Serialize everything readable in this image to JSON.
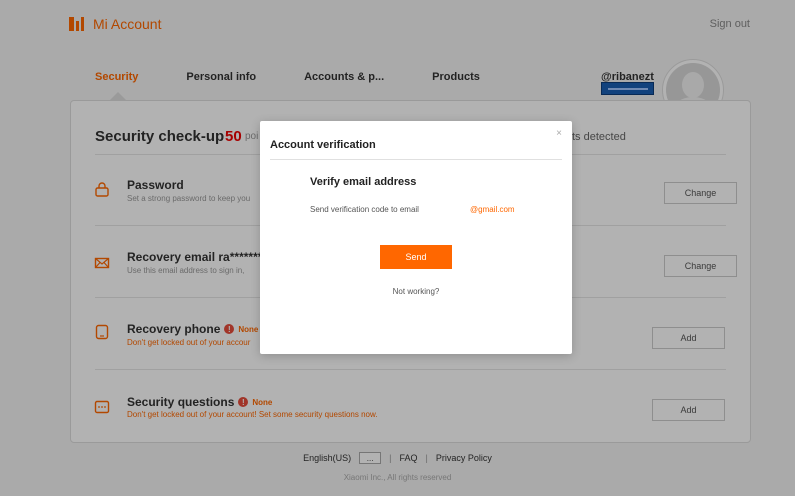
{
  "header": {
    "brand": "Mi Account",
    "sign_out": "Sign out"
  },
  "tabs": [
    "Security",
    "Personal info",
    "Accounts & p...",
    "Products"
  ],
  "user": {
    "name": "@ribanezt"
  },
  "checkup": {
    "title": "Security check-up",
    "score": "50",
    "points": "poi",
    "status": "ts detected"
  },
  "rows": [
    {
      "title": "Password",
      "desc": "Set a strong password to keep you",
      "button": "Change"
    },
    {
      "title": "Recovery email ra********",
      "desc": "Use this email address to sign in,",
      "button": "Change"
    },
    {
      "title": "Recovery phone",
      "badge": "None",
      "desc": "Don't get locked out of your accour",
      "button": "Add"
    },
    {
      "title": "Security questions",
      "badge": "None",
      "desc": "Don't get locked out of your account! Set some security questions now.",
      "button": "Add"
    }
  ],
  "footer": {
    "language": "English(US)",
    "lang_button": "...",
    "faq": "FAQ",
    "privacy": "Privacy Policy",
    "separator": "|",
    "copyright": "Xiaomi Inc., All rights reserved"
  },
  "modal": {
    "title": "Account verification",
    "close": "×",
    "heading": "Verify email address",
    "text": "Send verification code to email",
    "email": "@gmail.com",
    "send": "Send",
    "not_working": "Not working?"
  },
  "colors": {
    "accent": "#ff6700",
    "score": "#e00000"
  }
}
